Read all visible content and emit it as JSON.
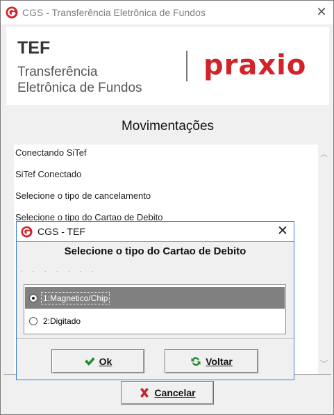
{
  "window": {
    "title": "CGS - Transferência Eletrônica de Fundos",
    "close_glyph": "✕"
  },
  "banner": {
    "tef_short": "TEF",
    "tef_line1": "Transferência",
    "tef_line2": "Eletrônica de Fundos",
    "brand_text": "praxio",
    "brand_color": "#d2232a"
  },
  "movements": {
    "title": "Movimentações",
    "items": [
      "Conectando SiTef",
      "SiTef Conectado",
      "Selecione o tipo de cancelamento",
      "Selecione o tipo do Cartao de Debito"
    ],
    "scroll_up_glyph": "︿",
    "scroll_down_glyph": "﹀"
  },
  "cancel_button": {
    "label": "Cancelar",
    "icon": "x-icon",
    "icon_color": "#c0262d"
  },
  "dialog": {
    "title": "CGS - TEF",
    "close_glyph": "✕",
    "heading": "Selecione o tipo do Cartao de Debito",
    "dots": ". . . . . . .",
    "options": [
      {
        "label": "1:Magnetico/Chip",
        "selected": true
      },
      {
        "label": "2:Digitado",
        "selected": false
      }
    ],
    "ok_button": {
      "label": "Ok",
      "icon": "checkmark-icon",
      "icon_color": "#1e8a2a"
    },
    "back_button": {
      "label": "Voltar",
      "icon": "refresh-icon",
      "icon_color": "#1e8a2a"
    }
  },
  "accent_color": "#3a7ad8"
}
